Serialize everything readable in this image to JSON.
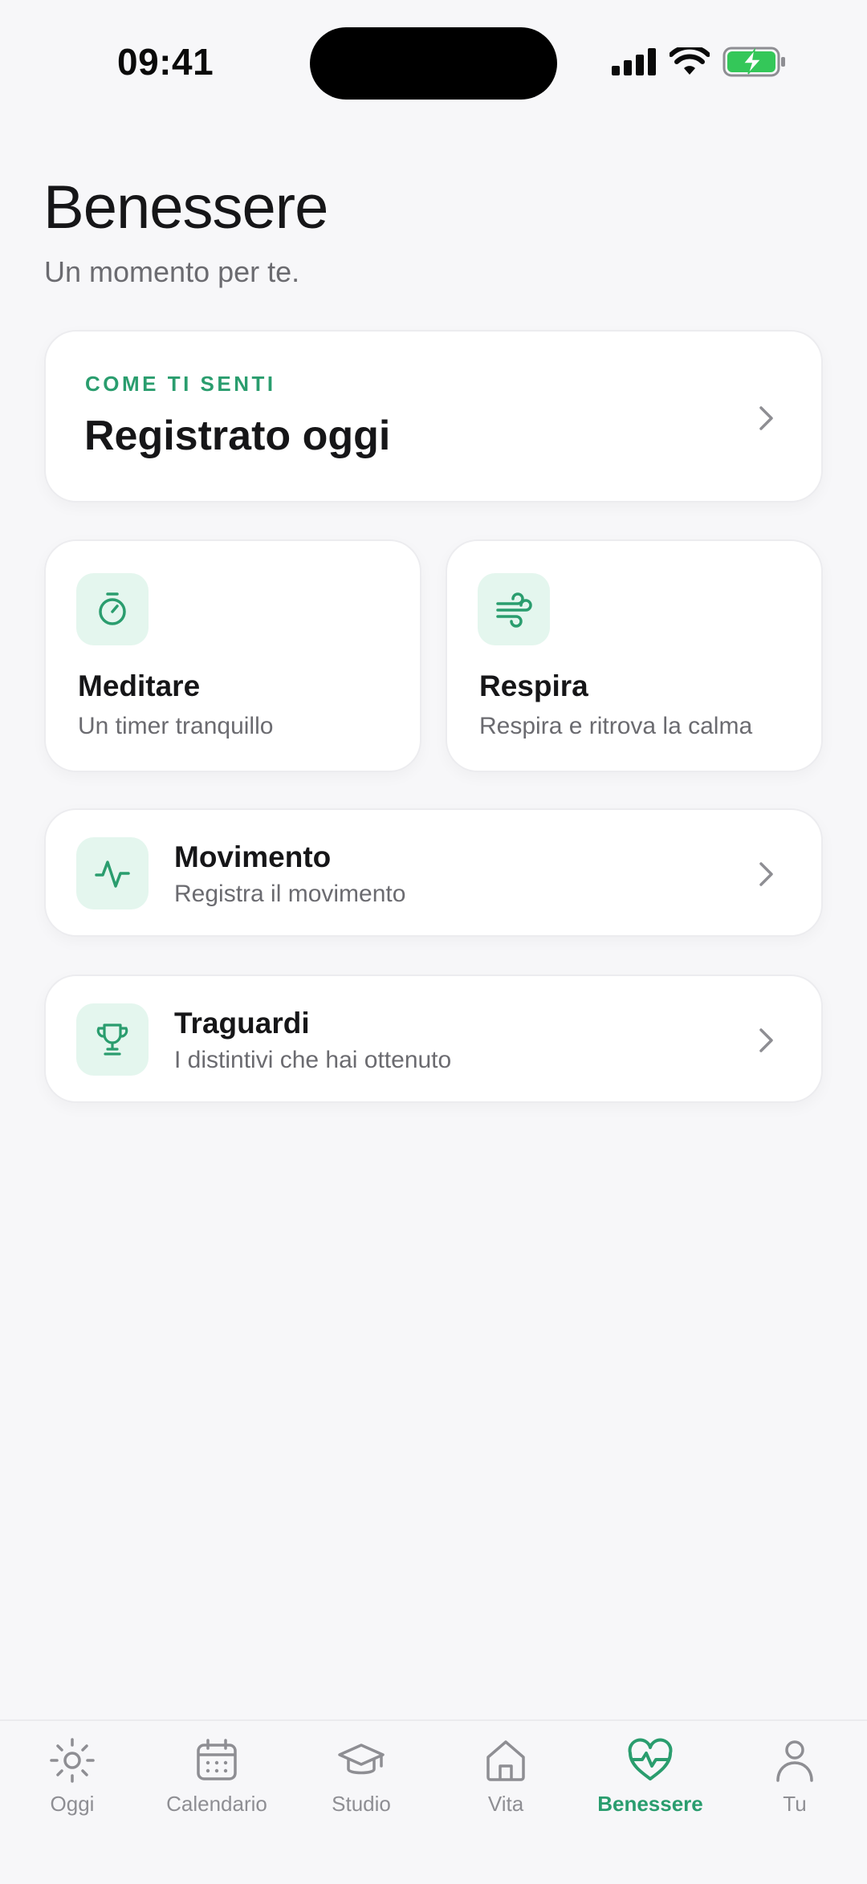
{
  "status_bar": {
    "time": "09:41"
  },
  "header": {
    "title": "Benessere",
    "subtitle": "Un momento per te."
  },
  "mood_card": {
    "eyebrow": "COME TI SENTI",
    "title": "Registrato oggi"
  },
  "tiles": [
    {
      "title": "Meditare",
      "subtitle": "Un timer tranquillo",
      "icon": "timer-icon"
    },
    {
      "title": "Respira",
      "subtitle": "Respira e ritrova la calma",
      "icon": "wind-icon"
    }
  ],
  "rows": [
    {
      "title": "Movimento",
      "subtitle": "Registra il movimento",
      "icon": "activity-icon"
    },
    {
      "title": "Traguardi",
      "subtitle": "I distintivi che hai ottenuto",
      "icon": "trophy-icon"
    }
  ],
  "tab_bar": {
    "active": "Benessere",
    "tabs": [
      {
        "label": "Oggi",
        "icon": "sun-icon"
      },
      {
        "label": "Calendario",
        "icon": "calendar-icon"
      },
      {
        "label": "Studio",
        "icon": "graduation-cap-icon"
      },
      {
        "label": "Vita",
        "icon": "home-icon"
      },
      {
        "label": "Benessere",
        "icon": "heart-pulse-icon"
      },
      {
        "label": "Tu",
        "icon": "person-icon"
      }
    ]
  },
  "colors": {
    "accent": "#2a9d6e",
    "accent_bg": "#e4f6ee",
    "background": "#f7f7f9",
    "muted": "#8e8e93"
  }
}
